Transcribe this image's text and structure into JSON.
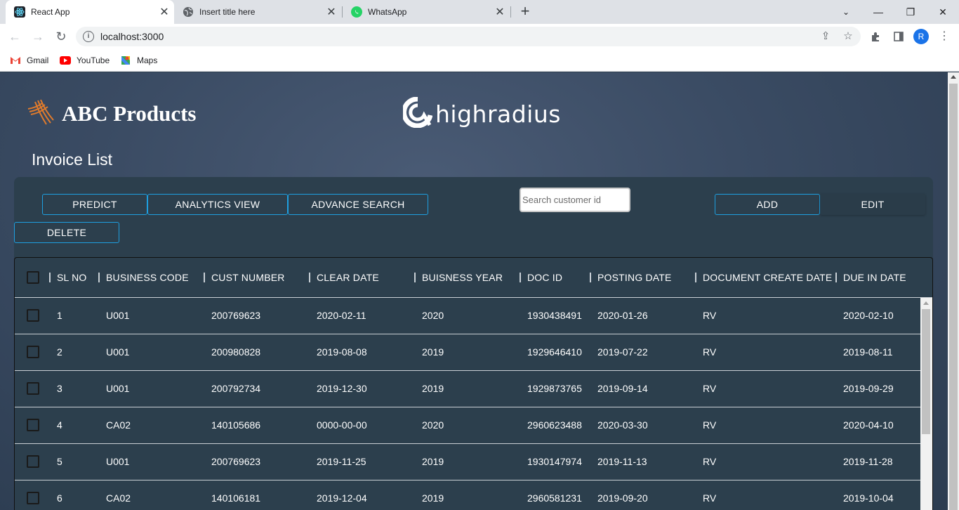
{
  "browser": {
    "tabs": [
      {
        "title": "React App",
        "icon": "react-icon",
        "active": true
      },
      {
        "title": "Insert title here",
        "icon": "globe-icon",
        "active": false
      },
      {
        "title": "WhatsApp",
        "icon": "whatsapp-icon",
        "active": false
      }
    ],
    "url": "localhost:3000",
    "profile_initial": "R",
    "bookmarks": [
      {
        "label": "Gmail",
        "icon": "gmail-icon"
      },
      {
        "label": "YouTube",
        "icon": "youtube-icon"
      },
      {
        "label": "Maps",
        "icon": "maps-icon"
      }
    ]
  },
  "app": {
    "brand": "ABC Products",
    "partner_logo": "highradius",
    "page_title": "Invoice List",
    "buttons": {
      "predict": "PREDICT",
      "analytics": "ANALYTICS VIEW",
      "advance_search": "ADVANCE SEARCH",
      "add": "ADD",
      "edit": "EDIT",
      "delete": "DELETE"
    },
    "search": {
      "placeholder": "Search customer id"
    },
    "table": {
      "columns": [
        "SL NO",
        "BUSINESS CODE",
        "CUST NUMBER",
        "CLEAR DATE",
        "BUISNESS YEAR",
        "DOC ID",
        "POSTING DATE",
        "DOCUMENT CREATE DATE",
        "DUE IN DATE"
      ],
      "rows": [
        [
          "1",
          "U001",
          "200769623",
          "2020-02-11",
          "2020",
          "1930438491",
          "2020-01-26",
          "RV",
          "2020-02-10"
        ],
        [
          "2",
          "U001",
          "200980828",
          "2019-08-08",
          "2019",
          "1929646410",
          "2019-07-22",
          "RV",
          "2019-08-11"
        ],
        [
          "3",
          "U001",
          "200792734",
          "2019-12-30",
          "2019",
          "1929873765",
          "2019-09-14",
          "RV",
          "2019-09-29"
        ],
        [
          "4",
          "CA02",
          "140105686",
          "0000-00-00",
          "2020",
          "2960623488",
          "2020-03-30",
          "RV",
          "2020-04-10"
        ],
        [
          "5",
          "U001",
          "200769623",
          "2019-11-25",
          "2019",
          "1930147974",
          "2019-11-13",
          "RV",
          "2019-11-28"
        ],
        [
          "6",
          "CA02",
          "140106181",
          "2019-12-04",
          "2019",
          "2960581231",
          "2019-09-20",
          "RV",
          "2019-10-04"
        ]
      ]
    }
  },
  "colors": {
    "accent": "#1e9fe0",
    "panel": "#2c3f4d",
    "background": "#3a4b63"
  }
}
